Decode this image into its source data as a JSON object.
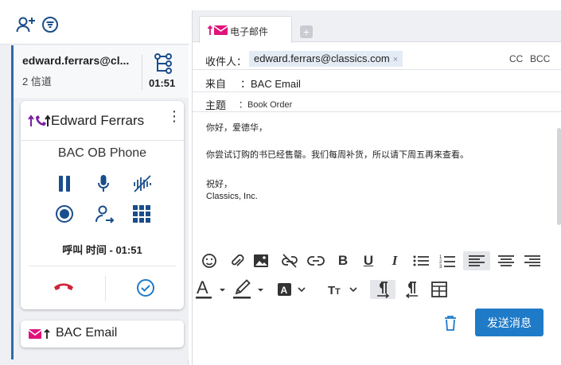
{
  "left_panel": {
    "conversation": {
      "email": "edward.ferrars@cl...",
      "channels": "2 信道",
      "elapsed": "01:51"
    },
    "call_card": {
      "contact_name": "Edward Ferrars",
      "queue": "BAC OB Phone",
      "call_time": "呼叫 时间 - 01:51"
    },
    "email_card": {
      "label": "BAC Email"
    }
  },
  "right_panel": {
    "tab": {
      "label": "电子邮件"
    },
    "to": {
      "label": "收件人：",
      "recipient": "edward.ferrars@classics.com",
      "remove": "×",
      "cc": "CC",
      "bcc": "BCC"
    },
    "from": {
      "label": "来自",
      "value": "：BAC Email"
    },
    "subject": {
      "label": "主题",
      "value": "：Book Order"
    },
    "body": {
      "line1": "你好，爱德华，",
      "line2": "你尝试订购的书已经售罄。我们每周补货，所以请下周五再来查看。",
      "line3": "祝好，",
      "line4": "Classics, Inc."
    },
    "send_button": "发送消息"
  },
  "colors": {
    "accent_blue": "#1f7ac8",
    "nav_blue": "#1a4d8c",
    "email_pink": "#e0137a",
    "hangup_red": "#d0243a",
    "call_purple": "#7a1fa2"
  }
}
